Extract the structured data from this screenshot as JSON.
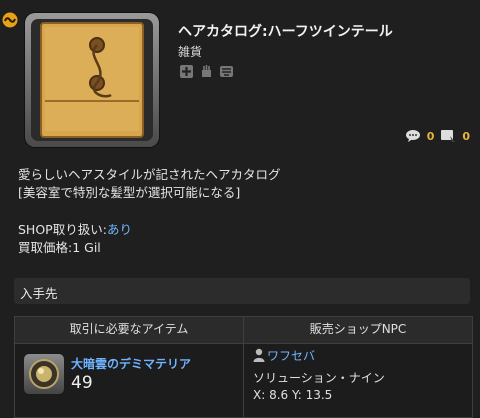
{
  "item": {
    "name": "ヘアカタログ:ハーフツインテール",
    "category": "雑貨",
    "badges": [
      "convertible-icon",
      "dyeable-icon",
      "market-icon"
    ],
    "icon": "envelope-icon"
  },
  "counters": {
    "comments": "0",
    "posts": "0"
  },
  "description": {
    "line1": "愛らしいヘアスタイルが記されたヘアカタログ",
    "line2": "[美容室で特別な髪型が選択可能になる]"
  },
  "shop": {
    "label": "SHOP取り扱い:",
    "value": "あり"
  },
  "price": {
    "label": "買取価格:",
    "value": "1 Gil"
  },
  "acquisition": {
    "title": "入手先",
    "headers": [
      "取引に必要なアイテム",
      "販売ショップNPC"
    ],
    "material": {
      "name": "大暗雲のデミマテリア",
      "quantity": "49"
    },
    "npc": {
      "name": "ワフセバ",
      "area": "ソリューション・ナイン",
      "coords": "X: 8.6 Y: 13.5"
    }
  },
  "colors": {
    "link": "#6fb4ff",
    "counter": "#e8b53a",
    "background": "#1f1f1f"
  }
}
